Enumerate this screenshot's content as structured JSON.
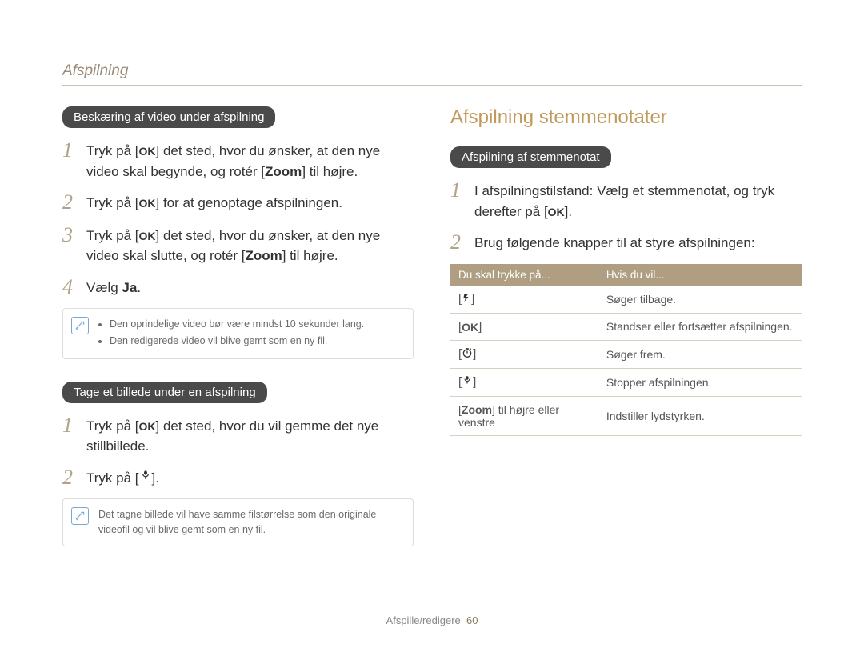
{
  "header": {
    "title": "Afspilning"
  },
  "left": {
    "section1": {
      "pill": "Beskæring af video under afspilning",
      "step1_pre": "Tryk på [",
      "step1_post": "] det sted, hvor du ønsker, at den nye video skal begynde, og rotér [",
      "step1_zoom": "Zoom",
      "step1_end": "] til højre.",
      "step2_pre": "Tryk på [",
      "step2_post": "] for at genoptage afspilningen.",
      "step3_pre": "Tryk på [",
      "step3_post": "] det sted, hvor du ønsker, at den nye video skal slutte, og rotér [",
      "step3_zoom": "Zoom",
      "step3_end": "] til højre.",
      "step4_pre": "Vælg ",
      "step4_bold": "Ja",
      "step4_end": ".",
      "note1": "Den oprindelige video bør være mindst 10 sekunder lang.",
      "note2": "Den redigerede video vil blive gemt som en ny fil."
    },
    "section2": {
      "pill": "Tage et billede under en afspilning",
      "step1_pre": "Tryk på [",
      "step1_post": "] det sted, hvor du vil gemme det nye stillbillede.",
      "step2_pre": "Tryk på [",
      "step2_post": "].",
      "note1": "Det tagne billede vil have samme filstørrelse som den originale videofil og vil blive gemt som en ny fil."
    }
  },
  "right": {
    "title": "Afspilning stemmenotater",
    "pill": "Afspilning af stemmenotat",
    "step1_pre": "I afspilningstilstand: Vælg et stemmenotat, og tryk derefter på [",
    "step1_post": "].",
    "step2": "Brug følgende knapper til at styre afspilningen:",
    "table": {
      "header1": "Du skal trykke på...",
      "header2": "Hvis du vil...",
      "rows": [
        {
          "icon": "flash-icon",
          "desc": "Søger tilbage."
        },
        {
          "icon": "ok-icon",
          "desc": "Standser eller fortsætter afspilningen."
        },
        {
          "icon": "timer-icon",
          "desc": "Søger frem."
        },
        {
          "icon": "macro-icon",
          "desc": "Stopper afspilningen."
        },
        {
          "key_pre": "[",
          "key_bold": "Zoom",
          "key_post": "] til højre eller venstre",
          "desc": "Indstiller lydstyrken."
        }
      ]
    }
  },
  "footer": {
    "section": "Afspille/redigere",
    "page": "60"
  },
  "icons": {
    "ok_label": "OK"
  }
}
